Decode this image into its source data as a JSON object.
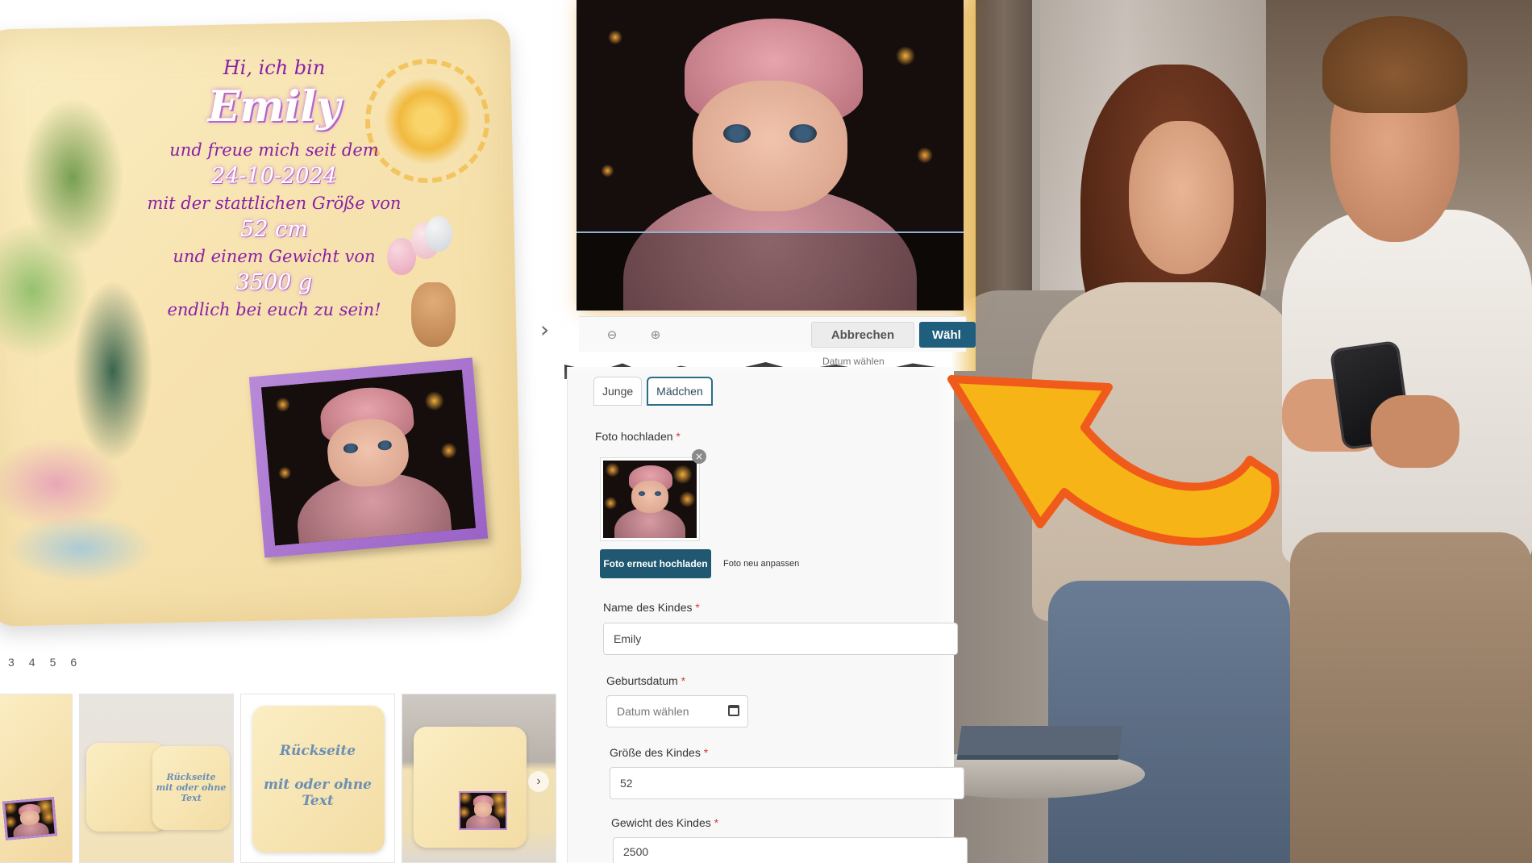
{
  "pillow": {
    "line_hi": "Hi, ich bin",
    "name": "Emily",
    "line_since": "und freue mich seit dem",
    "date": "24-10-2024",
    "line_size": "mit der stattlichen Größe von",
    "size": "52 cm",
    "line_weight": "und einem Gewicht von",
    "weight": "3500 g",
    "line_end": "endlich bei euch zu sein!"
  },
  "pager": [
    "3",
    "4",
    "5",
    "6"
  ],
  "thumbnails": {
    "back_text_line1": "Rückseite",
    "back_text_line2": "mit oder ohne Text"
  },
  "cropper": {
    "cancel_label": "Abbrechen",
    "select_label": "Wähl",
    "torn_label": "Datum wählen"
  },
  "form": {
    "tabs": [
      "Junge",
      "Mädchen"
    ],
    "active_tab": "Mädchen",
    "photo_label": "Foto hochladen",
    "required_mark": "*",
    "reupload_label": "Foto erneut hochladen",
    "adjust_label": "Foto neu anpassen",
    "name_label": "Name des Kindes",
    "name_value": "Emily",
    "birth_label": "Geburtsdatum",
    "birth_placeholder": "Datum wählen",
    "size_label": "Größe des Kindes",
    "size_value": "52",
    "weight_label": "Gewicht des Kindes",
    "weight_value": "2500"
  },
  "colors": {
    "accent": "#1f5870",
    "pillow_text": "#8b1fa8",
    "arrow_fill": "#f6b417",
    "arrow_stroke": "#f05a1a"
  },
  "icons": [
    "zoom-out-icon",
    "zoom-in-icon",
    "remove-photo-icon",
    "calendar-icon",
    "chevron-right-icon"
  ]
}
